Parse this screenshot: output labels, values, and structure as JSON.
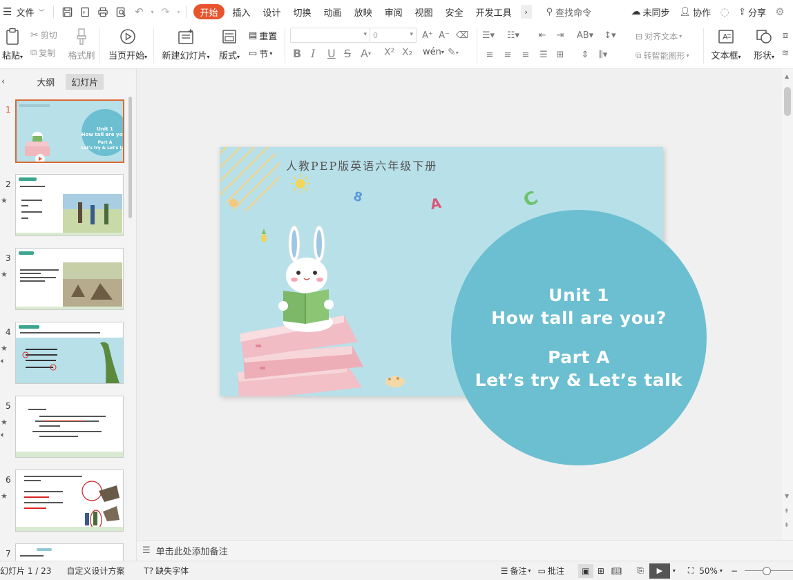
{
  "menu": {
    "file_label": "文件",
    "tabs": [
      "开始",
      "插入",
      "设计",
      "切换",
      "动画",
      "放映",
      "审阅",
      "视图",
      "安全",
      "开发工具"
    ],
    "search_label": "查找命令",
    "unsync_label": "未同步",
    "collab_label": "协作",
    "share_label": "分享"
  },
  "ribbon": {
    "paste": "粘贴",
    "cut": "剪切",
    "copy": "复制",
    "format_painter": "格式刷",
    "from_current": "当页开始",
    "new_slide": "新建幻灯片",
    "layout": "版式",
    "reset": "重置",
    "section": "节",
    "font_size": "0",
    "align_text": "对齐文本",
    "smart_shape": "转智能图形",
    "text_box": "文本框",
    "shape": "形状"
  },
  "left_panel": {
    "outline_tab": "大纲",
    "slides_tab": "幻灯片",
    "thumbnails": [
      {
        "num": "1"
      },
      {
        "num": "2"
      },
      {
        "num": "3"
      },
      {
        "num": "4"
      },
      {
        "num": "5"
      },
      {
        "num": "6"
      },
      {
        "num": "7"
      }
    ]
  },
  "slide": {
    "header": "人教PEP版英语六年级下册",
    "line1": "Unit 1",
    "line2": "How tall are you?",
    "line3": "Part A",
    "line4": "Let’s try & Let’s talk"
  },
  "notes_placeholder": "单击此处添加备注",
  "status": {
    "slide_info": "幻灯片 1 / 23",
    "design": "自定义设计方案",
    "missing_font": "缺失字体",
    "notes": "备注",
    "comments": "批注",
    "zoom": "50%"
  },
  "colors": {
    "accent": "#e8542d",
    "slide_bg": "#b8e0e9",
    "circle": "#6bbfd1"
  }
}
